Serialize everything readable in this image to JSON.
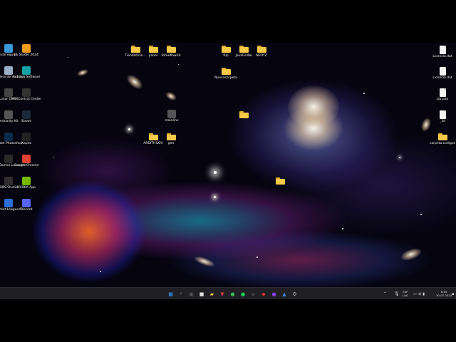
{
  "desktop": {
    "left_column": [
      {
        "label": "Este equipo",
        "icon": "pc-icon",
        "color": "#3a9ad9"
      },
      {
        "label": "FL Studio 2024",
        "icon": "flstudio-icon",
        "color": "#f29c1f"
      },
      {
        "label": "Papelera de reciclaje",
        "icon": "recycle-bin-icon",
        "color": "#9ab0c8"
      },
      {
        "label": "Arduino Software",
        "icon": "arduino-icon",
        "color": "#17a1a5"
      },
      {
        "label": "Lunar Client",
        "icon": "lunar-client-icon",
        "color": "#444"
      },
      {
        "label": "MSI Control Center",
        "icon": "msi-icon",
        "color": "#333"
      },
      {
        "label": "Arduinity Kit",
        "icon": "arduinity-icon",
        "color": "#555"
      },
      {
        "label": "Steam",
        "icon": "steam-icon",
        "color": "#1b2838"
      },
      {
        "label": "Adobe Photoshop",
        "icon": "photoshop-icon",
        "color": "#0b2b4a"
      },
      {
        "label": "Xapeo",
        "icon": "xapeo-icon",
        "color": "#222"
      },
      {
        "label": "Epic Games Launcher",
        "icon": "epic-games-icon",
        "color": "#2a2a2a"
      },
      {
        "label": "Google Chrome",
        "icon": "chrome-icon",
        "color": "#e34133"
      },
      {
        "label": "OBS Studio",
        "icon": "obs-icon",
        "color": "#302e31"
      },
      {
        "label": "NVIDIA App",
        "icon": "nvidia-icon",
        "color": "#76b900"
      },
      {
        "label": "Rocket League®",
        "icon": "rocket-league-icon",
        "color": "#2b6fd6"
      },
      {
        "label": "Discord",
        "icon": "discord-icon",
        "color": "#5865f2"
      }
    ],
    "middle_items": [
      {
        "label": "TiendaOcio...",
        "type": "folder"
      },
      {
        "label": "panel",
        "type": "folder"
      },
      {
        "label": "Streeflow2d",
        "type": "folder"
      },
      {
        "label": "mainline",
        "type": "app",
        "icon": "generic-app-icon"
      },
      {
        "label": "ARDITHILOV",
        "type": "folder"
      },
      {
        "label": "gen",
        "type": "folder"
      }
    ],
    "right_group": [
      {
        "label": "Rip",
        "type": "folder"
      },
      {
        "label": "JavaGridle",
        "type": "folder"
      },
      {
        "label": "NEOYZ",
        "type": "folder"
      },
      {
        "label": "Nuevacarpeta",
        "type": "folder"
      },
      {
        "label": "",
        "type": "folder"
      },
      {
        "label": "",
        "type": "folder"
      }
    ],
    "far_right": [
      {
        "label": "Licencia.dat",
        "type": "file"
      },
      {
        "label": "Licencia.dat",
        "type": "file"
      },
      {
        "label": "zip.pak",
        "type": "file"
      },
      {
        "label": "_3d",
        "type": "file"
      },
      {
        "label": "carpeta codigos",
        "type": "folder"
      }
    ]
  },
  "taskbar": {
    "items": [
      {
        "name": "start-icon",
        "glyph": "▦",
        "color": "#3aa0ff"
      },
      {
        "name": "search-icon",
        "glyph": "⌕",
        "color": "#888"
      },
      {
        "name": "task-view-icon",
        "glyph": "▣",
        "color": "#555"
      },
      {
        "name": "calendar-icon",
        "glyph": "■",
        "color": "#ddd"
      },
      {
        "name": "file-explorer-icon",
        "glyph": "▰",
        "color": "#f7c948"
      },
      {
        "name": "app-icon",
        "glyph": "▼",
        "color": "#d04040"
      },
      {
        "name": "chrome-icon",
        "glyph": "●",
        "color": "#3cba54"
      },
      {
        "name": "spotify-icon",
        "glyph": "●",
        "color": "#1ed760"
      },
      {
        "name": "app2-icon",
        "glyph": "▪",
        "color": "#444"
      },
      {
        "name": "app3-icon",
        "glyph": "◆",
        "color": "#e23030"
      },
      {
        "name": "app4-icon",
        "glyph": "●",
        "color": "#8a3ff0"
      },
      {
        "name": "app5-icon",
        "glyph": "▲",
        "color": "#3a8ad9"
      },
      {
        "name": "settings-icon",
        "glyph": "⚙",
        "color": "#aaa"
      }
    ],
    "tray": {
      "lang_top": "ESP",
      "lang_bottom": "LAA",
      "time": "8:45",
      "date": "30-07-2024"
    }
  },
  "colors": {
    "taskbar_bg": "#1f1f24",
    "folder": "#f7c948"
  }
}
